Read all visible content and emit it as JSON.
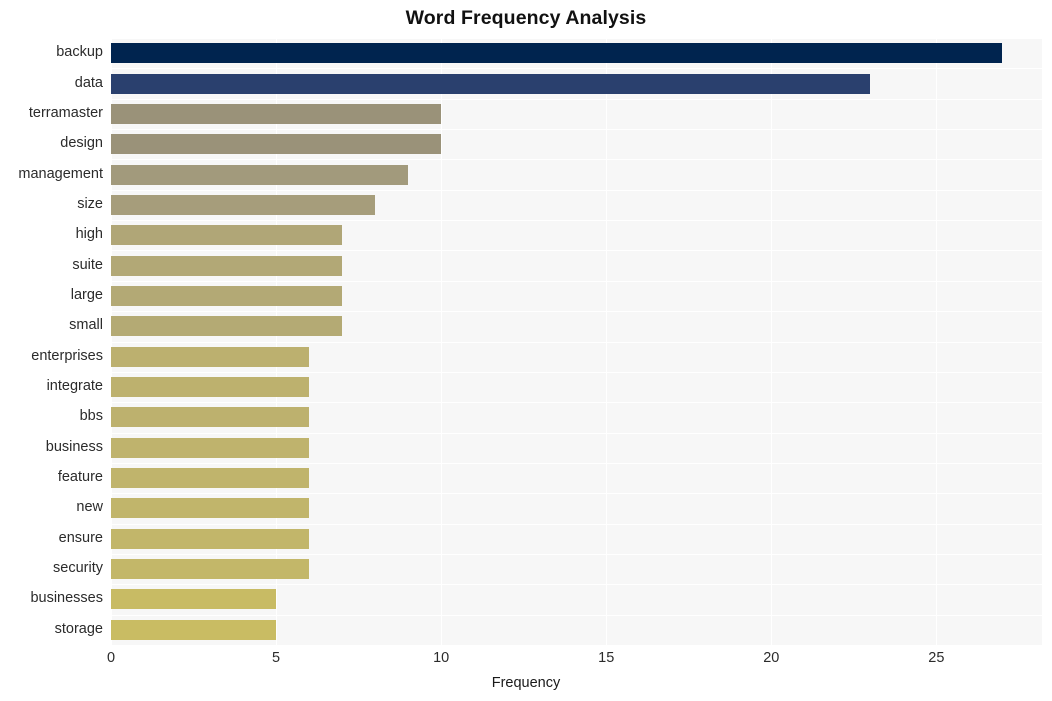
{
  "chart_data": {
    "type": "bar",
    "orientation": "horizontal",
    "title": "Word Frequency Analysis",
    "xlabel": "Frequency",
    "ylabel": "",
    "categories": [
      "backup",
      "data",
      "terramaster",
      "design",
      "management",
      "size",
      "high",
      "suite",
      "large",
      "small",
      "enterprises",
      "integrate",
      "bbs",
      "business",
      "feature",
      "new",
      "ensure",
      "security",
      "businesses",
      "storage"
    ],
    "values": [
      27,
      23,
      10,
      10,
      9,
      8,
      7,
      7,
      7,
      7,
      6,
      6,
      6,
      6,
      6,
      6,
      6,
      6,
      5,
      5
    ],
    "bar_colors": [
      "#00244f",
      "#2a406e",
      "#9a9279",
      "#9a9279",
      "#a29a7c",
      "#a69d7b",
      "#b0a677",
      "#b2a876",
      "#b3a975",
      "#b4aa74",
      "#bcb06f",
      "#bdb16e",
      "#bdb16e",
      "#bfb36d",
      "#c0b46c",
      "#c1b56b",
      "#c2b66a",
      "#c3b769",
      "#c8bb64",
      "#c9bc63"
    ],
    "xlim": [
      0,
      28.2
    ],
    "xticks": [
      0,
      5,
      10,
      15,
      20,
      25
    ],
    "xtick_labels": [
      "0",
      "5",
      "10",
      "15",
      "20",
      "25"
    ],
    "grid": {
      "vertical": true,
      "horizontal": true,
      "color": "#ffffff"
    },
    "plot_background": "#f7f7f7",
    "figure_background": "#ffffff",
    "legend": null
  }
}
